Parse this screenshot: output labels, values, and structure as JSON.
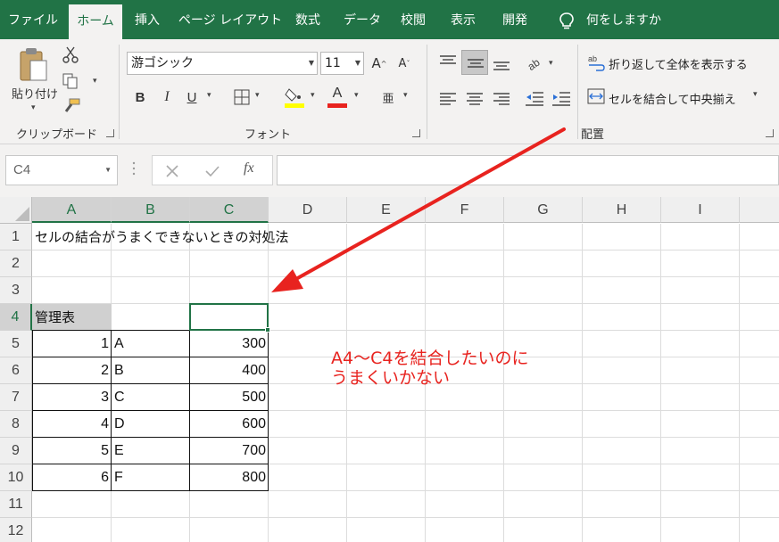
{
  "tabs": [
    {
      "label": "ファイル",
      "active": false
    },
    {
      "label": "ホーム",
      "active": true
    },
    {
      "label": "挿入",
      "active": false
    },
    {
      "label": "ページ レイアウト",
      "active": false
    },
    {
      "label": "数式",
      "active": false
    },
    {
      "label": "データ",
      "active": false
    },
    {
      "label": "校閲",
      "active": false
    },
    {
      "label": "表示",
      "active": false
    },
    {
      "label": "開発",
      "active": false
    }
  ],
  "tell_me": "何をしますか",
  "clipboard": {
    "paste_label": "貼り付け",
    "group_label": "クリップボード"
  },
  "font": {
    "name": "游ゴシック",
    "size": "11",
    "group_label": "フォント",
    "bold": "B",
    "italic": "I",
    "underline": "U",
    "font_color": "#e8231f",
    "fill_color": "#ffff00"
  },
  "alignment": {
    "wrap_text": "折り返して全体を表示する",
    "merge_center": "セルを結合して中央揃え",
    "group_label": "配置"
  },
  "formula_bar": {
    "name_box": "C4",
    "formula": "",
    "fx": "fx"
  },
  "columns": [
    "A",
    "B",
    "C",
    "D",
    "E",
    "F",
    "G",
    "H",
    "I"
  ],
  "rows": [
    "1",
    "2",
    "3",
    "4",
    "5",
    "6",
    "7",
    "8",
    "9",
    "10",
    "11",
    "12"
  ],
  "selected_cell": "C4",
  "sheet": {
    "title": "セルの結合がうまくできないときの対処法",
    "header_label": "管理表",
    "table": [
      {
        "no": "1",
        "code": "A",
        "value": "300"
      },
      {
        "no": "2",
        "code": "B",
        "value": "400"
      },
      {
        "no": "3",
        "code": "C",
        "value": "500"
      },
      {
        "no": "4",
        "code": "D",
        "value": "600"
      },
      {
        "no": "5",
        "code": "E",
        "value": "700"
      },
      {
        "no": "6",
        "code": "F",
        "value": "800"
      }
    ]
  },
  "annotation": {
    "line1": "A4～C4を結合したいのに",
    "line2": "うまくいかない",
    "color": "#e8231f"
  },
  "colors": {
    "accent": "#217346",
    "header_fill": "#d0d0d0",
    "arrow": "#e8231f"
  }
}
